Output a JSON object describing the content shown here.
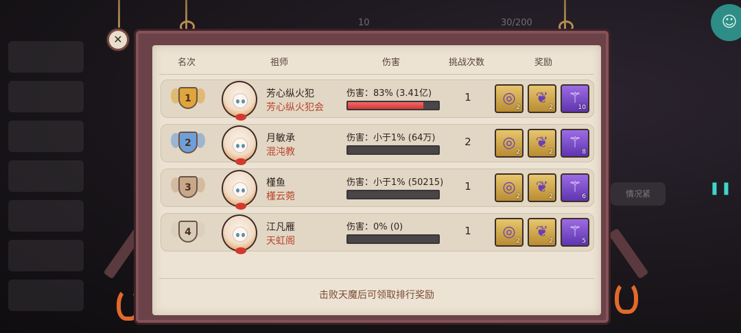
{
  "header": {
    "rank": "名次",
    "founder": "祖师",
    "damage": "伤害",
    "attempts": "挑战次数",
    "reward": "奖励"
  },
  "rows": [
    {
      "rank": "1",
      "badge": "gold",
      "name": "芳心纵火犯",
      "guild": "芳心纵火犯会",
      "damage_text": "伤害：83% (3.41亿)",
      "damage_fraction": 0.83,
      "attempts": "1",
      "rewards": [
        "2",
        "2",
        "10"
      ]
    },
    {
      "rank": "2",
      "badge": "silver",
      "name": "月敏承",
      "guild": "混沌教",
      "damage_text": "伤害：小于1% (64万)",
      "damage_fraction": 0.0,
      "attempts": "2",
      "rewards": [
        "2",
        "2",
        "8"
      ]
    },
    {
      "rank": "3",
      "badge": "bronze",
      "name": "槿鱼",
      "guild": "槿云菀",
      "damage_text": "伤害：小于1% (50215)",
      "damage_fraction": 0.0,
      "attempts": "1",
      "rewards": [
        "2",
        "2",
        "6"
      ]
    },
    {
      "rank": "4",
      "badge": "plain",
      "name": "江凡雁",
      "guild": "天虹阁",
      "damage_text": "伤害：0% (0)",
      "damage_fraction": 0.0,
      "attempts": "1",
      "rewards": [
        "2",
        "2",
        "5"
      ]
    }
  ],
  "footer_text": "击败天魔后可领取排行奖励",
  "close_icon": "close-icon",
  "colors": {
    "gold": "#e0a53c",
    "silver": "#6f9fd8",
    "bronze": "#c9a88a",
    "plain": "#d8cbb8",
    "damage_fill": "#d2393a"
  },
  "background": {
    "top_count": "10",
    "top_count2": "30/200",
    "tip": "情况紧"
  }
}
